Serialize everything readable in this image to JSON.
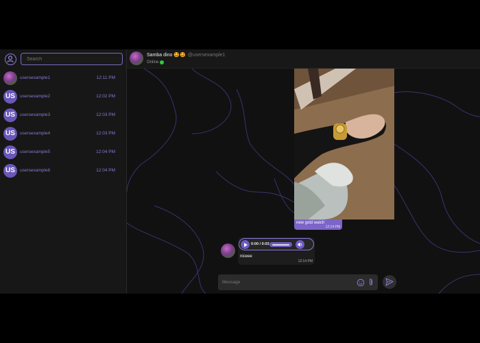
{
  "sidebar": {
    "search_placeholder": "Search",
    "contacts": [
      {
        "name": "usersexample1",
        "time": "12:11 PM",
        "avatar": "photo"
      },
      {
        "name": "usersexample2",
        "time": "12:02 PM",
        "avatar": "US"
      },
      {
        "name": "usersexample3",
        "time": "12:03 PM",
        "avatar": "US"
      },
      {
        "name": "usersexample4",
        "time": "12:03 PM",
        "avatar": "US"
      },
      {
        "name": "usersexample5",
        "time": "12:04 PM",
        "avatar": "US"
      },
      {
        "name": "usersexample6",
        "time": "12:04 PM",
        "avatar": "US"
      }
    ]
  },
  "header": {
    "name": "Samba dino 🤩🤩",
    "username": "@usersexample1",
    "status": "Online"
  },
  "messages": {
    "image_caption": "new gold watch",
    "image_time": "12:14 PM",
    "voice_time_label": "0:00 / 0:03",
    "voice_text": "niceee",
    "voice_time": "12:14 PM"
  },
  "composer": {
    "placeholder": "Message"
  },
  "colors": {
    "accent": "#7b65c7",
    "online": "#2ecc40",
    "background": "#111111"
  },
  "icons": [
    "user-circle-icon",
    "play-icon",
    "volume-icon",
    "emoji-icon",
    "paperclip-icon",
    "send-icon"
  ]
}
